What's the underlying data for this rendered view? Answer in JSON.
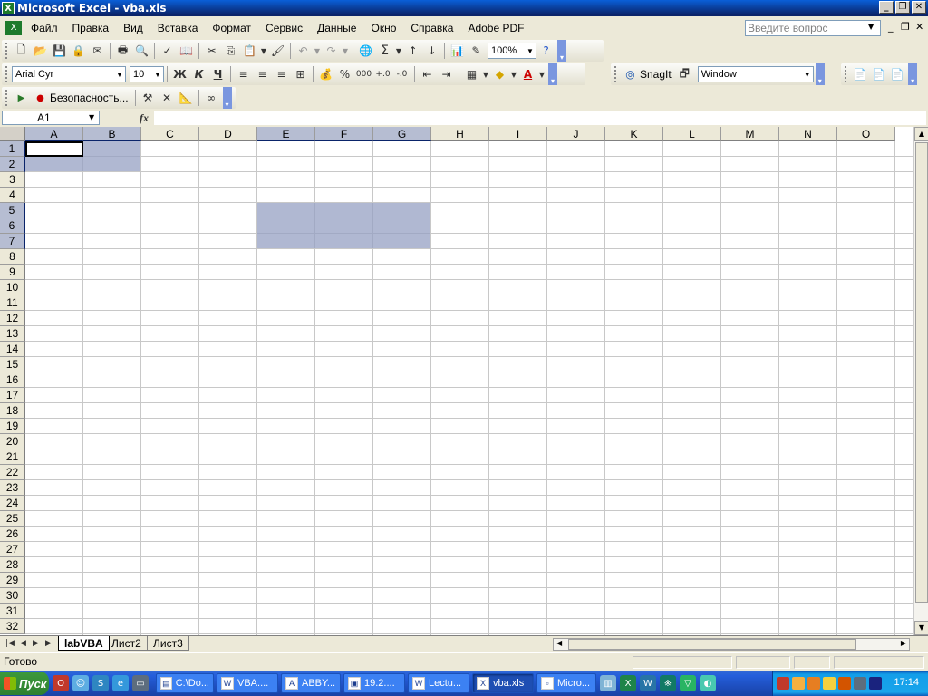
{
  "window": {
    "title": "Microsoft Excel - vba.xls"
  },
  "menu": [
    "Файл",
    "Правка",
    "Вид",
    "Вставка",
    "Формат",
    "Сервис",
    "Данные",
    "Окно",
    "Справка",
    "Adobe PDF"
  ],
  "ask": {
    "placeholder": "Введите вопрос"
  },
  "toolbar_standard": {
    "zoom": "100%",
    "sum": "Σ"
  },
  "toolbar_format": {
    "font": "Arial Cyr",
    "size": "10",
    "bold": "Ж",
    "italic": "К",
    "underline": "Ч",
    "percent": "%",
    "thousands": "000"
  },
  "toolbar_snagit": {
    "label": "SnagIt",
    "target": "Window"
  },
  "toolbar_vba": {
    "security": "Безопасность..."
  },
  "formula": {
    "namebox": "A1",
    "fx": "fx",
    "value": ""
  },
  "columns": [
    "A",
    "B",
    "C",
    "D",
    "E",
    "F",
    "G",
    "H",
    "I",
    "J",
    "K",
    "L",
    "M",
    "N",
    "O"
  ],
  "rows": [
    "1",
    "2",
    "3",
    "4",
    "5",
    "6",
    "7",
    "8",
    "9",
    "10",
    "11",
    "12",
    "13",
    "14",
    "15",
    "16",
    "17",
    "18",
    "19",
    "20",
    "21",
    "22",
    "23",
    "24",
    "25",
    "26",
    "27",
    "28",
    "29",
    "30",
    "31",
    "32"
  ],
  "selected_columns": [
    "A",
    "B",
    "E",
    "F",
    "G"
  ],
  "selected_rows": [
    "1",
    "2",
    "5",
    "6",
    "7"
  ],
  "sheets": [
    {
      "name": "labVBA",
      "active": true
    },
    {
      "name": "Лист2",
      "active": false
    },
    {
      "name": "Лист3",
      "active": false
    }
  ],
  "status": {
    "text": "Готово"
  },
  "taskbar": {
    "start": "Пуск",
    "tasks": [
      {
        "label": "C:\\Do...",
        "active": false
      },
      {
        "label": "VBA....",
        "active": false
      },
      {
        "label": "ABBY...",
        "active": false
      },
      {
        "label": "19.2....",
        "active": false
      },
      {
        "label": "Lectu...",
        "active": false
      },
      {
        "label": "vba.xls",
        "active": true
      },
      {
        "label": "Micro...",
        "active": false
      }
    ],
    "clock": "17:14"
  },
  "colors": {
    "selection": "#9aa3c3",
    "titlebar": "#0a246a",
    "taskbar": "#245edb"
  }
}
